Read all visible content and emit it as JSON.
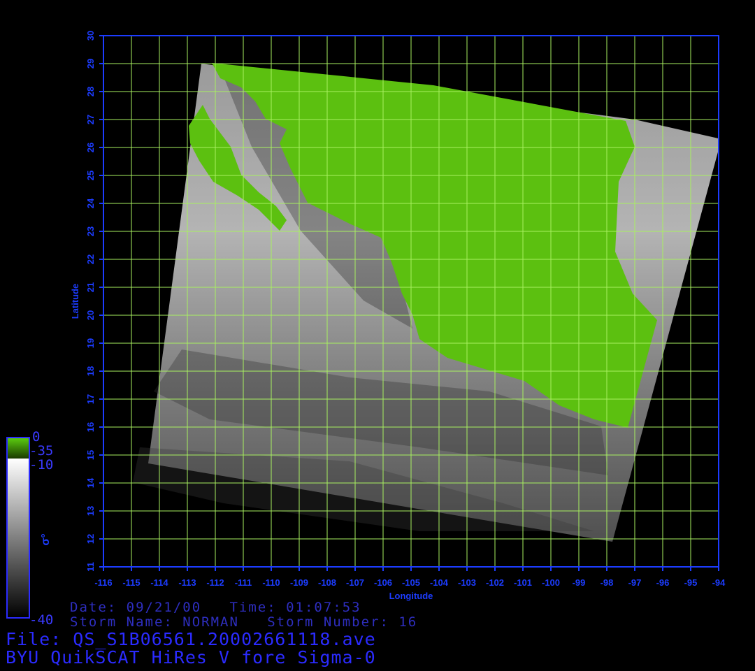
{
  "map": {
    "xlabel": "Longitude",
    "ylabel": "Latitude",
    "lon_range": [
      -116,
      -94
    ],
    "lat_range": [
      11,
      30
    ],
    "lon_ticks": [
      "-116",
      "-115",
      "-114",
      "-113",
      "-112",
      "-111",
      "-110",
      "-109",
      "-108",
      "-107",
      "-106",
      "-105",
      "-104",
      "-103",
      "-102",
      "-101",
      "-100",
      "-99",
      "-98",
      "-97",
      "-96",
      "-95",
      "-94"
    ],
    "lat_ticks": [
      "11",
      "12",
      "13",
      "14",
      "15",
      "16",
      "17",
      "18",
      "19",
      "20",
      "21",
      "22",
      "23",
      "24",
      "25",
      "26",
      "27",
      "28",
      "29",
      "30"
    ],
    "grid": true,
    "colors": {
      "axis": "#1c3cff",
      "grid": "#a8f060",
      "land": "#5cc010",
      "background": "#000000"
    },
    "swath_corners_lonlat": [
      [
        -112.5,
        29.0
      ],
      [
        -97.0,
        27.0
      ],
      [
        -93.9,
        26.3
      ],
      [
        -97.8,
        11.9
      ],
      [
        -114.4,
        14.7
      ]
    ],
    "land_mask_note": "Mexico mainland and Baja California shown in green"
  },
  "colorbar": {
    "label": "σ°",
    "land_max": "0",
    "land_min": "-35",
    "ocean_max": "-10",
    "ocean_min": "-40"
  },
  "info": {
    "line1": "Date: 09/21/00   Time: 01:07:53",
    "line2": "Storm Name: NORMAN   Storm Number: 16",
    "file": "File: QS_S1B06561.20002661118.ave",
    "product": "BYU QuikSCAT HiRes V fore Sigma-0"
  }
}
